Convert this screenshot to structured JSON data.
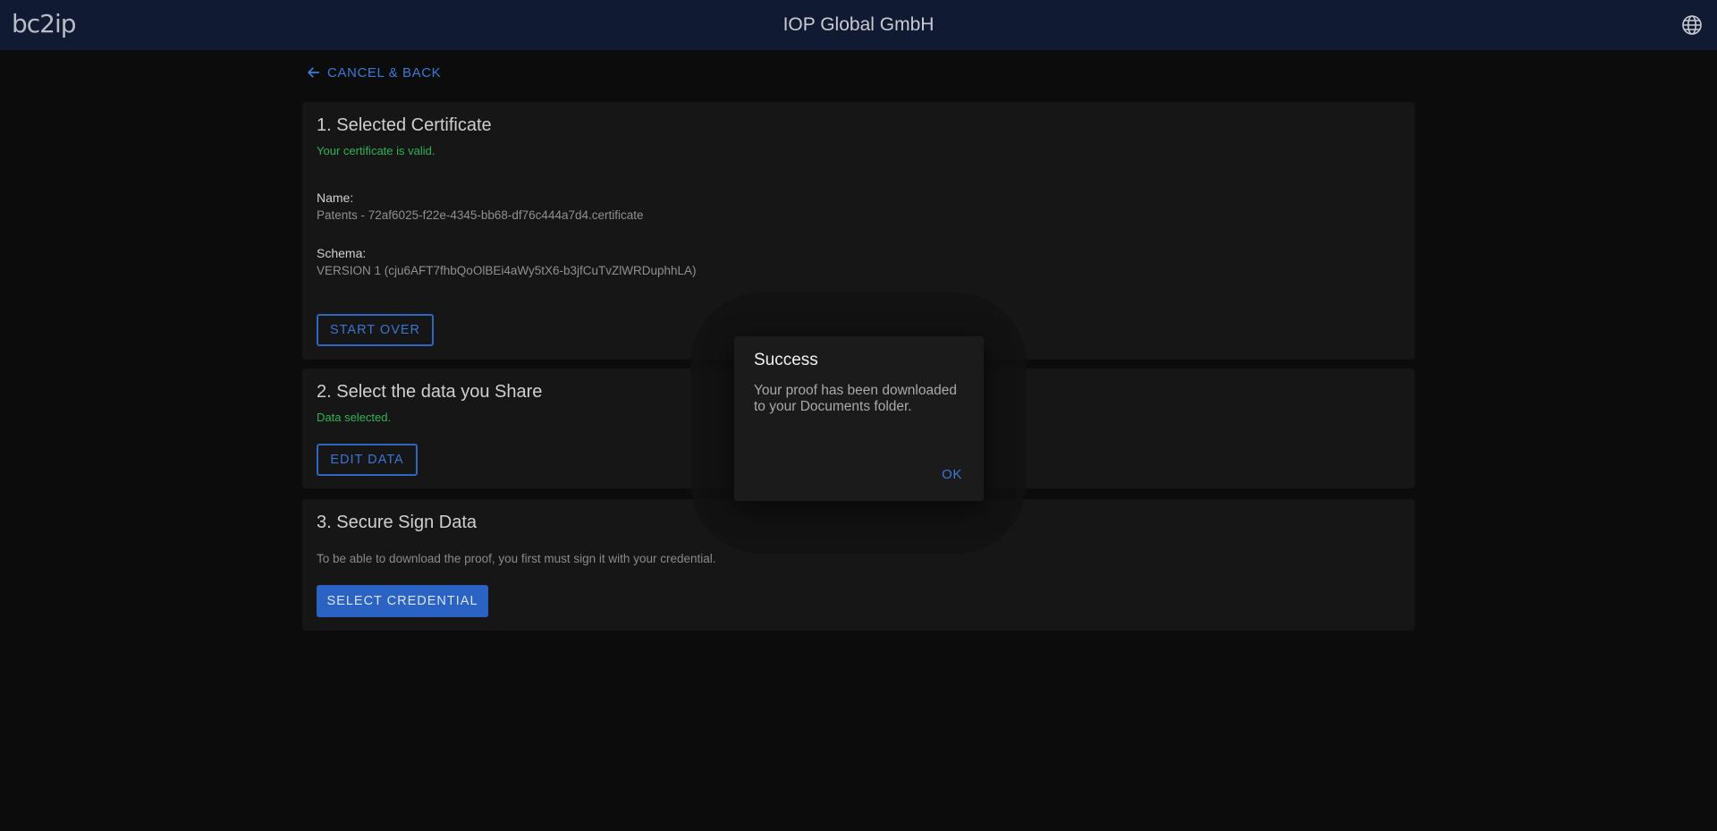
{
  "header": {
    "logo": "bc2ip",
    "title": "IOP Global GmbH",
    "language_icon": "globe-icon"
  },
  "nav": {
    "back_label": "CANCEL & BACK",
    "back_icon": "arrow-left-icon"
  },
  "step1": {
    "title": "1. Selected Certificate",
    "status": "Your certificate is valid.",
    "name_label": "Name:",
    "name_value": "Patents - 72af6025-f22e-4345-bb68-df76c444a7d4.certificate",
    "schema_label": "Schema:",
    "schema_value": "VERSION 1 (cju6AFT7fhbQoOlBEi4aWy5tX6-b3jfCuTvZlWRDuphhLA)",
    "button": "START OVER"
  },
  "step2": {
    "title": "2. Select the data you Share",
    "status": "Data selected.",
    "button": "EDIT DATA"
  },
  "step3": {
    "title": "3. Secure Sign Data",
    "description": "To be able to download the proof, you first must sign it with your credential.",
    "button": "SELECT CREDENTIAL"
  },
  "dialog": {
    "title": "Success",
    "message": "Your proof has been downloaded to your Documents folder.",
    "ok_label": "OK"
  },
  "colors": {
    "accent": "#2f66bf",
    "success": "#2fb357",
    "header_bg": "#101a33"
  }
}
